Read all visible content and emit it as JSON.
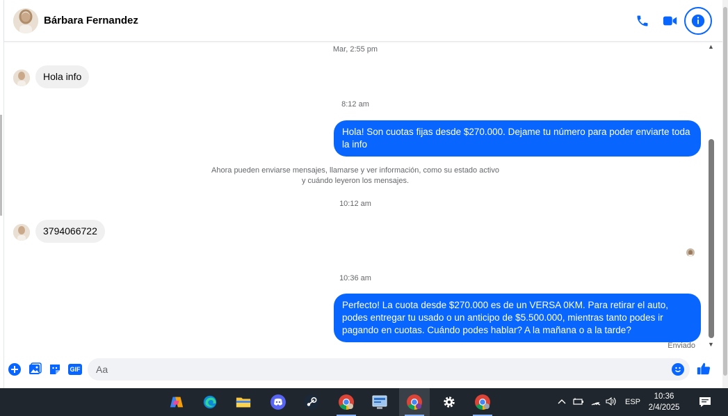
{
  "header": {
    "contact_name": "Bárbara Fernandez",
    "icons": [
      "phone-icon",
      "video-camera-icon",
      "info-icon"
    ]
  },
  "messages": {
    "ts1": "Mar, 2:55 pm",
    "msg1": "Hola info",
    "ts2": "8:12 am",
    "msg2": "Hola! Son cuotas fijas desde $270.000. Dejame tu número para poder enviarte toda la info",
    "notice_line1": "Ahora pueden enviarse mensajes, llamarse y ver información, como su estado activo",
    "notice_line2": "y cuándo leyeron los mensajes.",
    "ts3": "10:12 am",
    "msg3": "3794066722",
    "ts4": "10:36 am",
    "msg4": "Perfecto! La cuota desde $270.000 es de un VERSA 0KM. Para retirar el auto, podes entregar tu usado o un anticipo de $5.500.000, mientras tanto podes ir pagando en cuotas. Cuándo podes hablar? A la mañana o a la tarde?",
    "status": "Enviado"
  },
  "composer": {
    "placeholder": "Aa",
    "icons": [
      "add-icon",
      "image-icon",
      "sticker-icon",
      "gif-icon",
      "emoji-icon",
      "like-icon"
    ],
    "gif_label": "GIF"
  },
  "taskbar": {
    "apps": [
      "copilot",
      "edge",
      "file-explorer",
      "discord",
      "steam",
      "chrome-profile-1",
      "control-panel",
      "chrome-profile-2",
      "settings",
      "chrome-profile-3"
    ],
    "lang": "ESP",
    "time": "10:36",
    "date": "2/4/2025"
  },
  "colors": {
    "accent": "#0866ff",
    "bubble_in": "#f0f0f0",
    "taskbar": "#20262d"
  }
}
